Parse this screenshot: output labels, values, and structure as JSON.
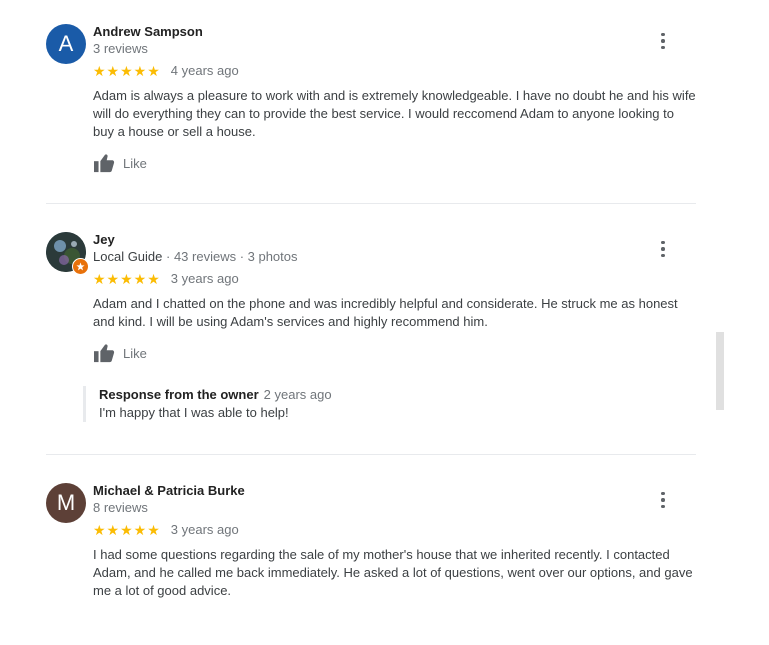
{
  "reviews": [
    {
      "avatar_letter": "A",
      "avatar_color": "#1a5ba8",
      "name": "Andrew Sampson",
      "meta": "3 reviews",
      "stars": "★★★★★",
      "date": "4 years ago",
      "text": "Adam is always a pleasure to work with and is extremely knowledgeable. I have no doubt he and his wife will do everything they can to provide the best service. I would reccomend Adam to anyone looking to buy a house or sell a house.",
      "like_label": "Like"
    },
    {
      "avatar_letter": "",
      "name": "Jey",
      "meta_guide": "Local Guide",
      "meta_rest": " · 43 reviews · 3 photos",
      "stars": "★★★★★",
      "date": "3 years ago",
      "text": "Adam and I chatted on the phone and was incredibly helpful and considerate.  He struck me as honest and kind.  I will be using Adam's services and highly recommend him.",
      "like_label": "Like",
      "owner_response": {
        "title": "Response from the owner",
        "date": "2 years ago",
        "text": "I'm happy that I was able to help!"
      }
    },
    {
      "avatar_letter": "M",
      "avatar_color": "#5d4037",
      "name": "Michael & Patricia Burke",
      "meta": "8 reviews",
      "stars": "★★★★★",
      "date": "3 years ago",
      "text": "I had some questions regarding the sale of my mother's house that we inherited recently. I contacted Adam, and he called me back immediately. He asked a lot of questions,  went over our options, and gave me a lot of good advice."
    }
  ],
  "colors": {
    "star": "#fbbc04",
    "local_guide_badge": "#e8710a"
  },
  "icons": {
    "like": "thumbs-up-icon",
    "more": "more-vert-icon"
  }
}
